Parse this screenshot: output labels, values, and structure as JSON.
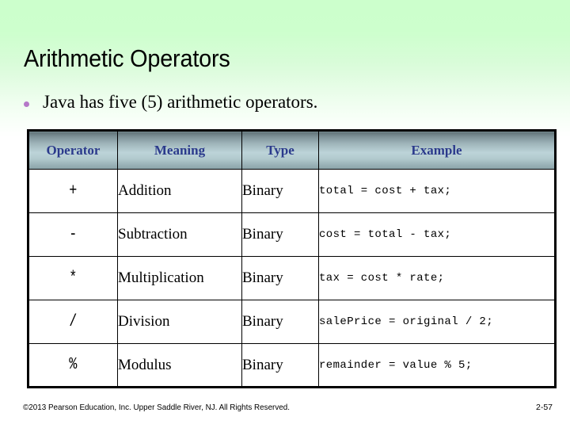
{
  "slide": {
    "title": "Arithmetic Operators",
    "bullet": "Java has five (5) arithmetic operators.",
    "bullet_marker": "bullet-dot",
    "background_top_color": "#ccffcc",
    "background_bottom_color": "#ffffff",
    "bullet_color": "#b578c8"
  },
  "table": {
    "header_text_color": "#2b3a8c",
    "header_gradient_top": "#5f7176",
    "header_gradient_mid": "#bcd3d8",
    "header_gradient_bottom": "#8ba4a9",
    "columns": [
      "Operator",
      "Meaning",
      "Type",
      "Example"
    ],
    "rows": [
      {
        "operator": "+",
        "meaning": "Addition",
        "type": "Binary",
        "example": "total = cost + tax;"
      },
      {
        "operator": "-",
        "meaning": "Subtraction",
        "type": "Binary",
        "example": "cost = total - tax;"
      },
      {
        "operator": "*",
        "meaning": "Multiplication",
        "type": "Binary",
        "example": "tax = cost * rate;"
      },
      {
        "operator": "/",
        "meaning": "Division",
        "type": "Binary",
        "example": "salePrice = original / 2;"
      },
      {
        "operator": "%",
        "meaning": "Modulus",
        "type": "Binary",
        "example": "remainder = value % 5;"
      }
    ]
  },
  "footer": {
    "copyright": "©2013 Pearson Education, Inc. Upper Saddle River, NJ. All Rights Reserved.",
    "page_number": "2-57"
  }
}
